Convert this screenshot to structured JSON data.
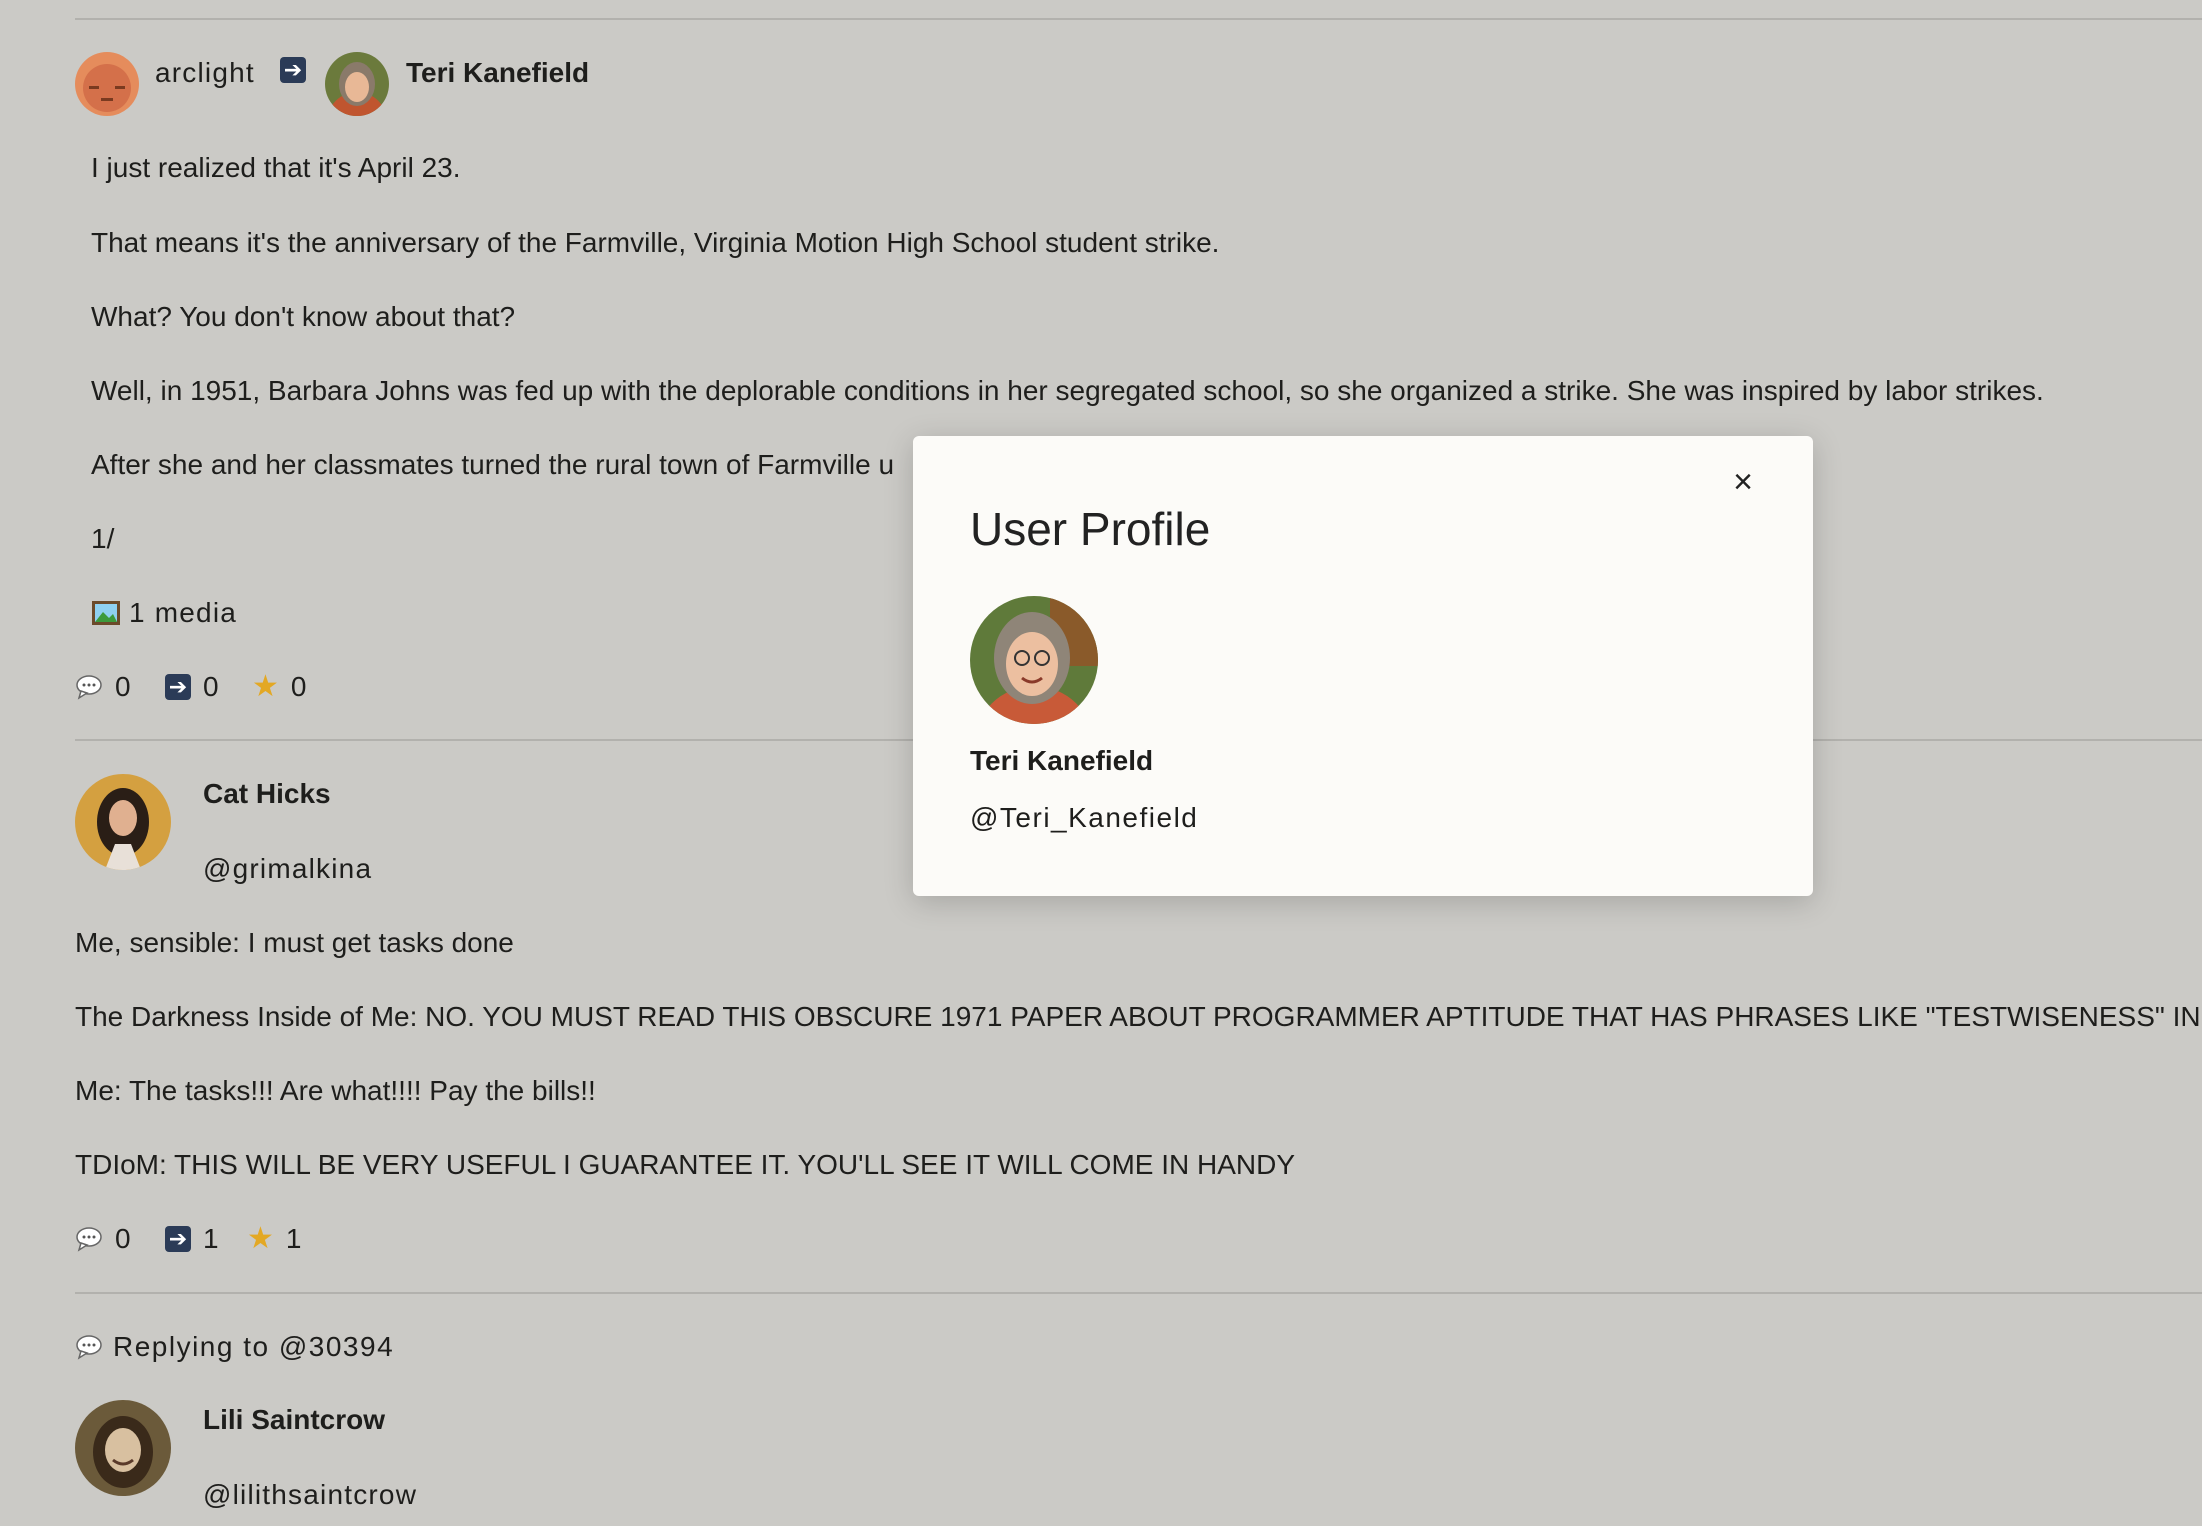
{
  "post1": {
    "booster_name": "arclight",
    "author_name": "Teri Kanefield",
    "paragraphs": [
      "I just realized that it's April 23.",
      "That means it's the anniversary of the Farmville, Virginia Motion High School student strike.",
      "What? You don't know about that?",
      "Well, in 1951, Barbara Johns was fed up with the deplorable conditions in her segregated school, so she organized a strike. She was inspired by labor strikes.",
      "After she and her classmates turned the rural town of Farmville u",
      "1/"
    ],
    "media_label": "1 media",
    "replies": "0",
    "boosts": "0",
    "favorites": "0"
  },
  "post2": {
    "author_name": "Cat Hicks",
    "author_handle": "@grimalkina",
    "paragraphs": [
      "Me, sensible: I must get tasks done",
      "The Darkness Inside of Me: NO. YOU MUST READ THIS OBSCURE 1971 PAPER ABOUT PROGRAMMER APTITUDE THAT HAS PHRASES LIKE \"TESTWISENESS\" IN IT",
      "Me: The tasks!!! Are what!!!! Pay the bills!!",
      "TDIoM: THIS WILL BE VERY USEFUL I GUARANTEE IT. YOU'LL SEE IT WILL COME IN HANDY"
    ],
    "replies": "0",
    "boosts": "1",
    "favorites": "1"
  },
  "post3": {
    "reply_label": "Replying to @30394",
    "author_name": "Lili Saintcrow",
    "author_handle": "@lilithsaintcrow"
  },
  "modal": {
    "title": "User Profile",
    "close_glyph": "×",
    "name": "Teri Kanefield",
    "handle": "@Teri_Kanefield"
  },
  "icons": {
    "reply": "speech-bubble-icon",
    "boost": "right-arrow-icon",
    "favorite": "star-icon",
    "media": "framed-picture-icon"
  },
  "colors": {
    "page_background": "#cbcac6",
    "modal_background": "#fcfbf8",
    "boost_icon": "#2b3b57",
    "star": "#e3a824"
  }
}
